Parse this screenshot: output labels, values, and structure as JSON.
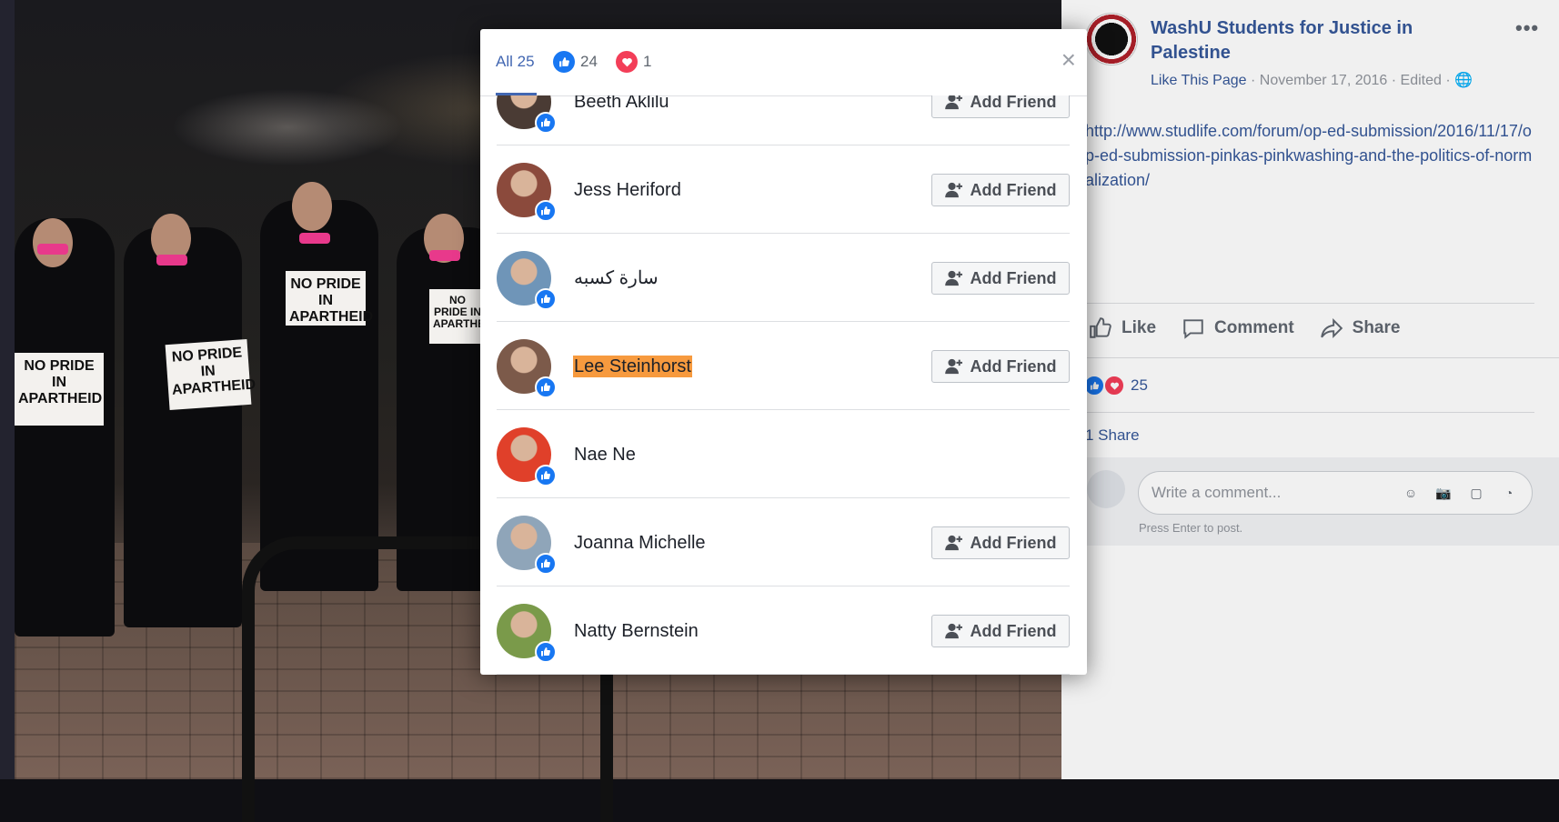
{
  "post": {
    "page_name": "WashU Students for Justice in Palestine",
    "like_page": "Like This Page",
    "meta_rest": " · November 17, 2016 · Edited · ",
    "link": "http://www.studlife.com/forum/op-ed-submission/2016/11/17/op-ed-submission-pinkas-pinkwashing-and-the-politics-of-normalization/",
    "actions": {
      "like": "Like",
      "comment": "Comment",
      "share": "Share"
    },
    "reaction_count": "25",
    "share_label": "1 Share",
    "comment_placeholder": "Write a comment...",
    "press_enter": "Press Enter to post.",
    "more_icon": "more-dots-icon"
  },
  "photo": {
    "signs": [
      "NO PRIDE IN APARTHEID",
      "NO PRIDE IN APARTHEID",
      "NO PRIDE IN APARTHEID",
      "NO PRIDE IN APARTHEID"
    ]
  },
  "modal": {
    "tabs": {
      "all": "All 25",
      "like_count": "24",
      "love_count": "1"
    },
    "add_friend_label": "Add Friend",
    "people": [
      {
        "name": "Beeth Aklilu",
        "avatar_color": "#4a3b34",
        "add_friend": true,
        "highlight": false
      },
      {
        "name": "Jess Heriford",
        "avatar_color": "#8b4a3c",
        "add_friend": true,
        "highlight": false
      },
      {
        "name": "سارة كسبه",
        "avatar_color": "#6f95b8",
        "add_friend": true,
        "highlight": false
      },
      {
        "name": "Lee Steinhorst",
        "avatar_color": "#7c5a4a",
        "add_friend": true,
        "highlight": true
      },
      {
        "name": "Nae Ne",
        "avatar_color": "#e0402a",
        "add_friend": false,
        "highlight": false
      },
      {
        "name": "Joanna Michelle",
        "avatar_color": "#8fa5b9",
        "add_friend": true,
        "highlight": false
      },
      {
        "name": "Natty Bernstein",
        "avatar_color": "#7a9a4a",
        "add_friend": true,
        "highlight": false
      }
    ]
  },
  "colors": {
    "facebook_blue": "#4267b2",
    "link_blue": "#365899",
    "like_blue": "#1877f2",
    "love_red": "#f33e58",
    "highlight": "#f79a3e"
  }
}
